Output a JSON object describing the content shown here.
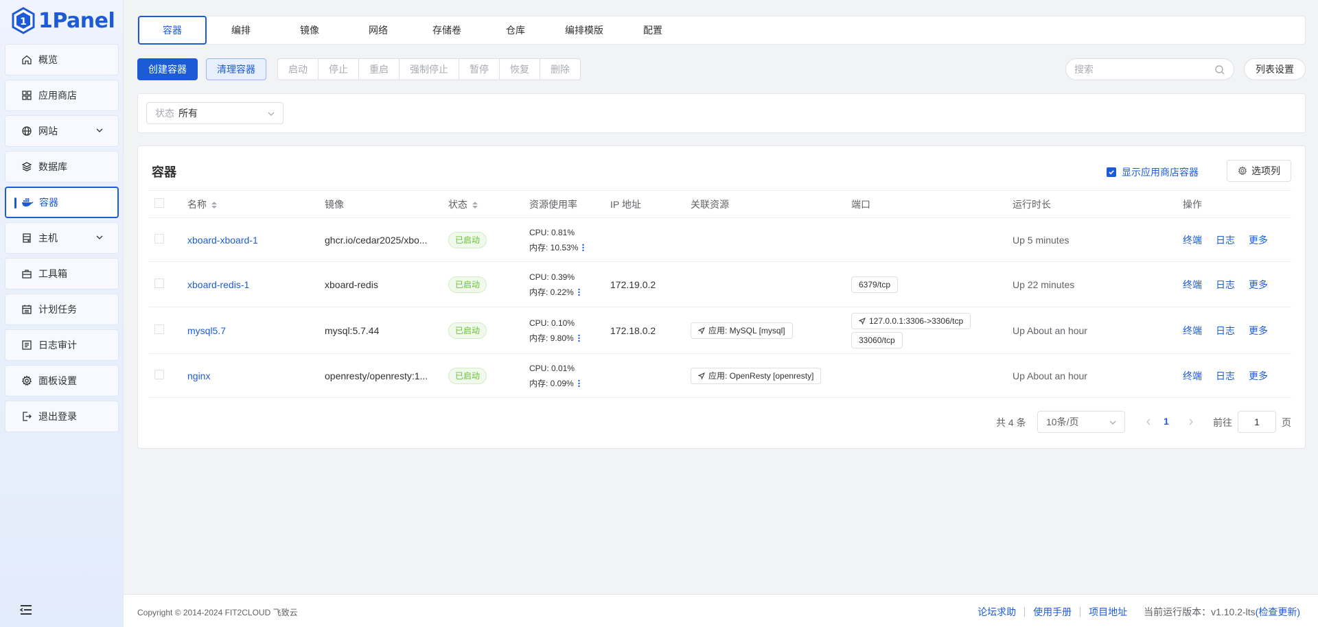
{
  "app": {
    "logo_text": "1Panel"
  },
  "sidebar": {
    "items": [
      {
        "label": "概览",
        "icon": "home-icon"
      },
      {
        "label": "应用商店",
        "icon": "grid-icon"
      },
      {
        "label": "网站",
        "icon": "globe-icon"
      },
      {
        "label": "数据库",
        "icon": "layers-icon"
      },
      {
        "label": "容器",
        "icon": "docker-icon"
      },
      {
        "label": "主机",
        "icon": "server-icon"
      },
      {
        "label": "工具箱",
        "icon": "toolbox-icon"
      },
      {
        "label": "计划任务",
        "icon": "calendar-icon"
      },
      {
        "label": "日志审计",
        "icon": "log-icon"
      },
      {
        "label": "面板设置",
        "icon": "gear-icon"
      },
      {
        "label": "退出登录",
        "icon": "logout-icon"
      }
    ]
  },
  "tabs": [
    "容器",
    "编排",
    "镜像",
    "网络",
    "存储卷",
    "仓库",
    "编排模版",
    "配置"
  ],
  "toolbar": {
    "create_label": "创建容器",
    "clean_label": "清理容器",
    "actions": [
      "启动",
      "停止",
      "重启",
      "强制停止",
      "暂停",
      "恢复",
      "删除"
    ],
    "search_placeholder": "搜索",
    "list_settings_label": "列表设置"
  },
  "filter": {
    "status_label": "状态",
    "status_value": "所有"
  },
  "table": {
    "title": "容器",
    "show_store_label": "显示应用商店容器",
    "columns_btn_label": "选项列",
    "headers": {
      "name": "名称",
      "image": "镜像",
      "status": "状态",
      "resource": "资源使用率",
      "ip": "IP 地址",
      "assoc": "关联资源",
      "port": "端口",
      "uptime": "运行时长",
      "ops": "操作"
    },
    "rows": [
      {
        "name": "xboard-xboard-1",
        "image": "ghcr.io/cedar2025/xbo...",
        "status": "已启动",
        "cpu": "CPU: 0.81%",
        "mem": "内存: 10.53%",
        "ip": "",
        "assoc": "",
        "ports": [],
        "uptime": "Up 5 minutes"
      },
      {
        "name": "xboard-redis-1",
        "image": "xboard-redis",
        "status": "已启动",
        "cpu": "CPU: 0.39%",
        "mem": "内存: 0.22%",
        "ip": "172.19.0.2",
        "assoc": "",
        "ports": [
          "6379/tcp"
        ],
        "uptime": "Up 22 minutes"
      },
      {
        "name": "mysql5.7",
        "image": "mysql:5.7.44",
        "status": "已启动",
        "cpu": "CPU: 0.10%",
        "mem": "内存: 9.80%",
        "ip": "172.18.0.2",
        "assoc": "应用: MySQL [mysql]",
        "ports": [
          "127.0.0.1:3306->3306/tcp",
          "33060/tcp"
        ],
        "uptime": "Up About an hour"
      },
      {
        "name": "nginx",
        "image": "openresty/openresty:1...",
        "status": "已启动",
        "cpu": "CPU: 0.01%",
        "mem": "内存: 0.09%",
        "ip": "",
        "assoc": "应用: OpenResty [openresty]",
        "ports": [],
        "uptime": "Up About an hour"
      }
    ],
    "ops": [
      "终端",
      "日志",
      "更多"
    ]
  },
  "pager": {
    "total": "共 4 条",
    "page_size": "10条/页",
    "current": "1",
    "goto_label": "前往",
    "goto_value": "1",
    "page_unit": "页"
  },
  "footer": {
    "copyright": "Copyright © 2014-2024 FIT2CLOUD 飞致云",
    "forum": "论坛求助",
    "manual": "使用手册",
    "project": "项目地址",
    "version": "当前运行版本：v1.10.2-lts",
    "check_update": "(检查更新)"
  },
  "colors": {
    "primary": "#1d5bd6",
    "running": "#67c23a"
  }
}
